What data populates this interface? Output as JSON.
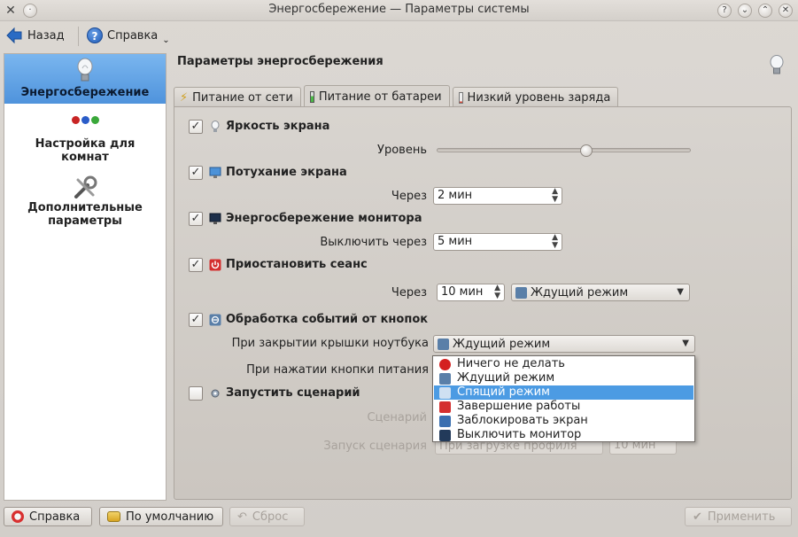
{
  "window": {
    "title": "Энергосбережение — Параметры системы"
  },
  "toolbar": {
    "back_label": "Назад",
    "help_label": "Справка"
  },
  "sidebar": {
    "items": [
      {
        "label": "Энергосбережение",
        "icon": "lightbulb-icon",
        "active": true
      },
      {
        "label": "Настройка для комнат",
        "icon": "activities-icon",
        "active": false
      },
      {
        "label": "Дополнительные параметры",
        "icon": "tools-icon",
        "active": false
      }
    ]
  },
  "main": {
    "title": "Параметры энергосбережения",
    "tabs": [
      {
        "label": "Питание от сети",
        "icon": "ac-plug-icon",
        "active": false
      },
      {
        "label": "Питание от батареи",
        "icon": "battery-icon",
        "active": true
      },
      {
        "label": "Низкий уровень заряда",
        "icon": "battery-low-icon",
        "active": false
      }
    ]
  },
  "settings": {
    "brightness": {
      "label": "Яркость экрана",
      "checked": true,
      "level_label": "Уровень",
      "level": 0.59
    },
    "dim": {
      "label": "Потухание экрана",
      "checked": true,
      "after_label": "Через",
      "after_value": "2 мин"
    },
    "dpms": {
      "label": "Энергосбережение монитора",
      "checked": true,
      "off_label": "Выключить через",
      "off_value": "5 мин"
    },
    "suspend": {
      "label": "Приостановить сеанс",
      "checked": true,
      "after_label": "Через",
      "after_value": "10 мин",
      "mode_value": "Ждущий режим"
    },
    "buttons": {
      "label": "Обработка событий от кнопок",
      "checked": true,
      "lid_label": "При закрытии крышки ноутбука",
      "lid_value": "Ждущий режим",
      "power_label": "При нажатии кнопки питания"
    },
    "script": {
      "label": "Запустить сценарий",
      "checked": false,
      "script_label": "Сценарий",
      "run_label": "Запуск сценария",
      "run_value": "При загрузке профиля",
      "run_time": "10 мин"
    }
  },
  "popup": {
    "items": [
      {
        "label": "Ничего не делать",
        "icon": "stop-icon",
        "color": "#d42020"
      },
      {
        "label": "Ждущий режим",
        "icon": "standby-icon",
        "color": "#5a7fa8"
      },
      {
        "label": "Спящий режим",
        "icon": "hibernate-icon",
        "color": "#9cb8d8",
        "selected": true
      },
      {
        "label": "Завершение работы",
        "icon": "power-icon",
        "color": "#d43030"
      },
      {
        "label": "Заблокировать экран",
        "icon": "lock-icon",
        "color": "#3a6fb0"
      },
      {
        "label": "Выключить монитор",
        "icon": "monitor-icon",
        "color": "#223a5a"
      }
    ]
  },
  "footer": {
    "help_label": "Справка",
    "defaults_label": "По умолчанию",
    "reset_label": "Сброс",
    "apply_label": "Применить"
  }
}
